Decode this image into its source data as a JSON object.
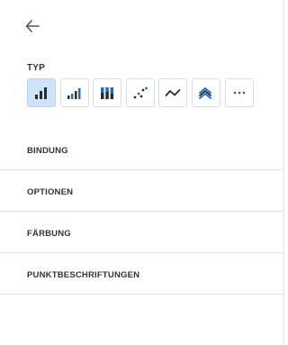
{
  "panel": {
    "type_label": "TYP",
    "chart_types": [
      {
        "icon": "bar-chart-icon",
        "selected": true
      },
      {
        "icon": "bar-chart-split-icon",
        "selected": false
      },
      {
        "icon": "stacked-bar-icon",
        "selected": false
      },
      {
        "icon": "scatter-plot-icon",
        "selected": false
      },
      {
        "icon": "line-chart-icon",
        "selected": false
      },
      {
        "icon": "area-chart-icon",
        "selected": false
      },
      {
        "icon": "more-options-icon",
        "selected": false
      }
    ],
    "sections": [
      {
        "label": "BINDUNG"
      },
      {
        "label": "OPTIONEN"
      },
      {
        "label": "FÄRBUNG"
      },
      {
        "label": "PUNKTBESCHRIFTUNGEN"
      }
    ]
  },
  "colors": {
    "accent": "#1b6ec2",
    "selected_bg": "#cfe3fa",
    "icon_dark": "#2b2b2b"
  }
}
